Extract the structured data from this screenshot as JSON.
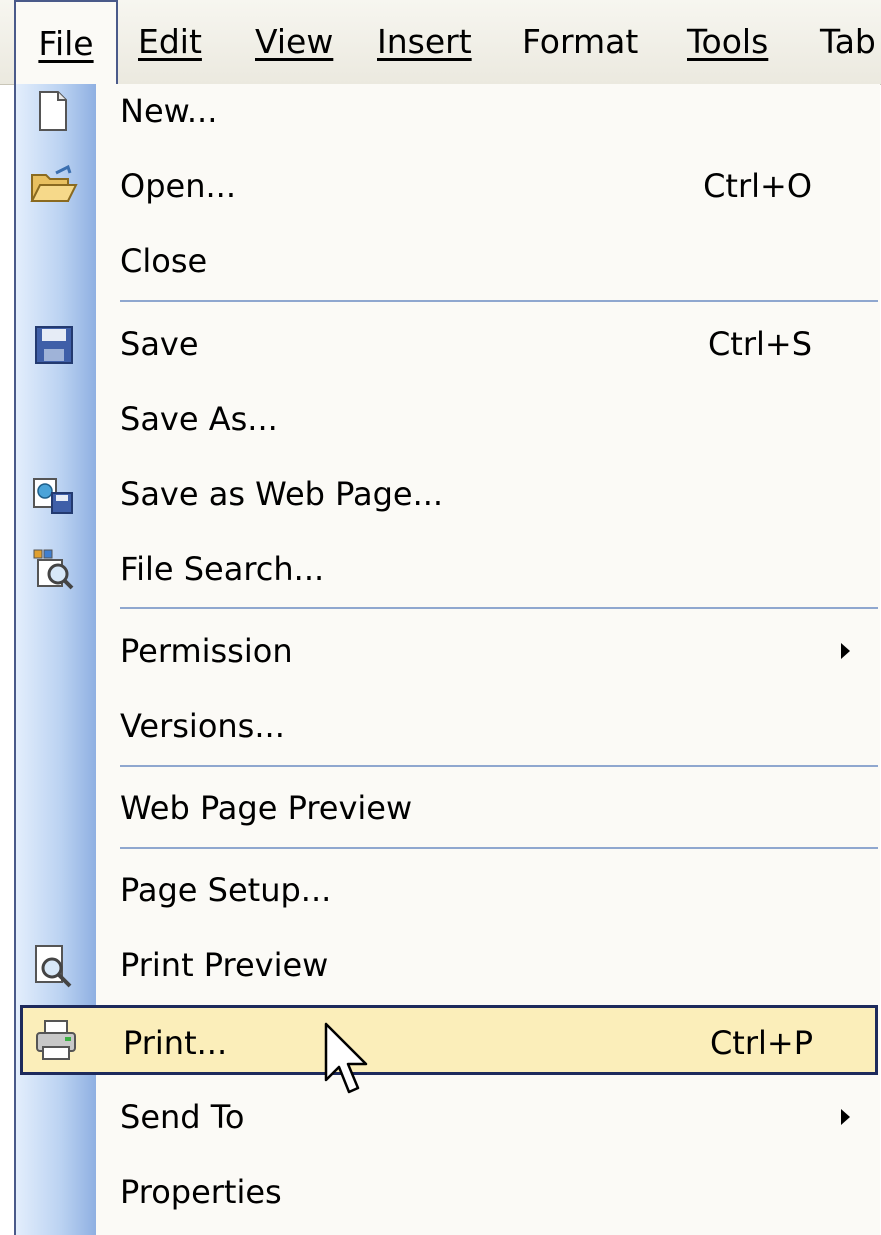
{
  "menubar": {
    "items": [
      {
        "label": "File",
        "active": true
      },
      {
        "label": "Edit"
      },
      {
        "label": "View"
      },
      {
        "label": "Insert"
      },
      {
        "label": "Format"
      },
      {
        "label": "Tools"
      },
      {
        "label": "Tab"
      }
    ]
  },
  "file_menu": {
    "items": [
      {
        "label": "New...",
        "icon": "new-document-icon"
      },
      {
        "label": "Open...",
        "shortcut": "Ctrl+O",
        "icon": "open-folder-icon"
      },
      {
        "label": "Close"
      },
      {
        "label": "Save",
        "shortcut": "Ctrl+S",
        "icon": "save-floppy-icon"
      },
      {
        "label": "Save As..."
      },
      {
        "label": "Save as Web Page...",
        "icon": "save-web-page-icon"
      },
      {
        "label": "File Search...",
        "icon": "file-search-icon"
      },
      {
        "label": "Permission",
        "submenu": true
      },
      {
        "label": "Versions..."
      },
      {
        "label": "Web Page Preview"
      },
      {
        "label": "Page Setup..."
      },
      {
        "label": "Print Preview",
        "icon": "print-preview-icon"
      },
      {
        "label": "Print...",
        "shortcut": "Ctrl+P",
        "icon": "printer-icon",
        "highlighted": true
      },
      {
        "label": "Send To",
        "submenu": true
      },
      {
        "label": "Properties"
      }
    ]
  },
  "colors": {
    "highlight_fill": "#fbeeba",
    "highlight_border": "#1d2a5c",
    "gutter": "#bcd3f2",
    "separator": "#8fa7cf"
  }
}
